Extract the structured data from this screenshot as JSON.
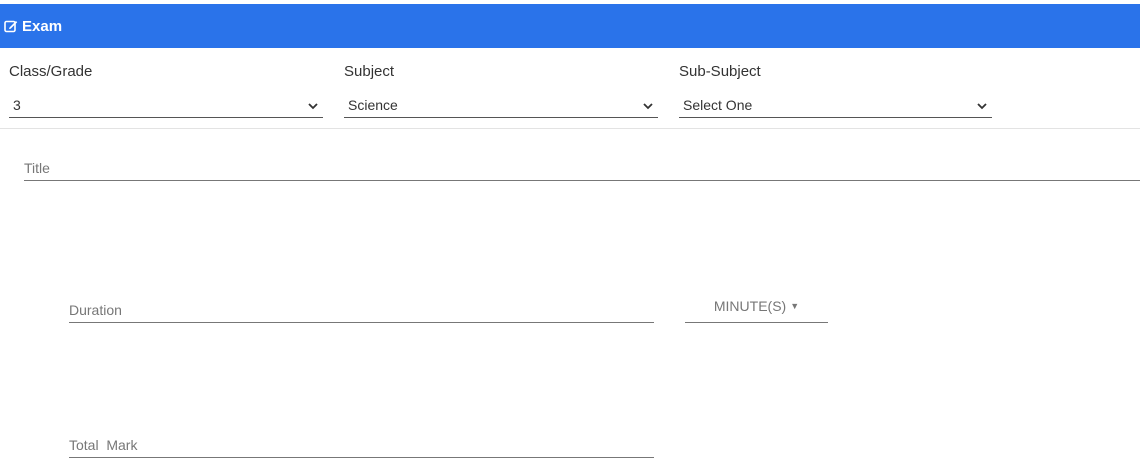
{
  "header": {
    "title": "Exam",
    "icon": "edit-icon",
    "color": "#2a73ea"
  },
  "filters": {
    "class_grade": {
      "label": "Class/Grade",
      "value": "3"
    },
    "subject": {
      "label": "Subject",
      "value": "Science"
    },
    "sub_subject": {
      "label": "Sub-Subject",
      "value": "Select One"
    }
  },
  "form": {
    "title_placeholder": "Title",
    "duration_placeholder": "Duration",
    "duration_unit": "MINUTE(S)",
    "total_mark_placeholder": "Total  Mark"
  }
}
